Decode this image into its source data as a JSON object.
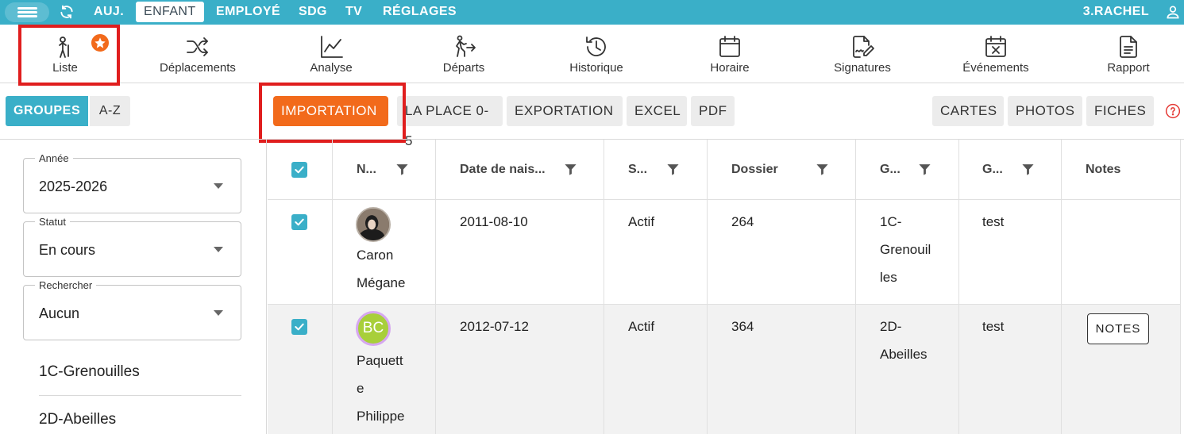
{
  "topbar": {
    "nav": [
      "AUJ.",
      "ENFANT",
      "EMPLOYÉ",
      "SDG",
      "TV",
      "RÉGLAGES"
    ],
    "active_nav": "ENFANT",
    "user": "3.RACHEL"
  },
  "toolbar": {
    "items": [
      "Liste",
      "Déplacements",
      "Analyse",
      "Départs",
      "Historique",
      "Horaire",
      "Signatures",
      "Événements",
      "Rapport"
    ]
  },
  "actions": {
    "groupes": "GROUPES",
    "az": "A-Z",
    "importation": "IMPORTATION",
    "la_place": "LA PLACE 0-5",
    "exportation": "EXPORTATION",
    "excel": "EXCEL",
    "pdf": "PDF",
    "cartes": "CARTES",
    "photos": "PHOTOS",
    "fiches": "FICHES"
  },
  "filters": {
    "annee": {
      "label": "Année",
      "value": "2025-2026"
    },
    "statut": {
      "label": "Statut",
      "value": "En cours"
    },
    "rechercher": {
      "label": "Rechercher",
      "value": "Aucun"
    }
  },
  "groups": [
    "1C-Grenouilles",
    "2D-Abeilles"
  ],
  "table": {
    "columns": [
      "N...",
      "Date de nais...",
      "S...",
      "Dossier",
      "G...",
      "G...",
      "Notes"
    ],
    "rows": [
      {
        "name_lines": [
          "Caron",
          "Mégane"
        ],
        "birth": "2011-08-10",
        "status": "Actif",
        "dossier": "264",
        "group_lines": [
          "1C-",
          "Grenouil",
          "les"
        ],
        "g2": "test",
        "notes": ""
      },
      {
        "initials": "BC",
        "name_lines": [
          "Paquett",
          "e",
          "Philippe"
        ],
        "birth": "2012-07-12",
        "status": "Actif",
        "dossier": "364",
        "group_lines": [
          "2D-",
          "Abeilles"
        ],
        "g2": "test",
        "notes": "NOTES"
      }
    ]
  },
  "colors": {
    "accent": "#3aafc8",
    "highlight_button": "#f26a1b",
    "annotation_box": "#e01e1e"
  }
}
